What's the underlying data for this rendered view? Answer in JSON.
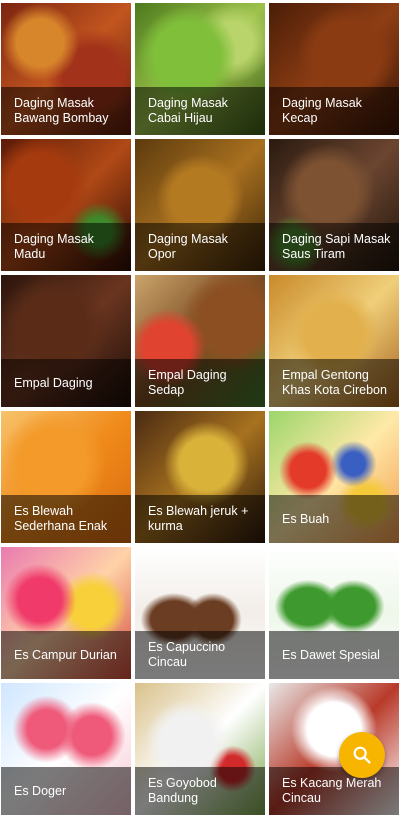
{
  "recipes": [
    {
      "title": "Daging Masak Bawang Bombay"
    },
    {
      "title": "Daging Masak Cabai Hijau"
    },
    {
      "title": "Daging Masak Kecap"
    },
    {
      "title": "Daging Masak Madu"
    },
    {
      "title": "Daging Masak Opor"
    },
    {
      "title": "Daging Sapi Masak Saus Tiram"
    },
    {
      "title": "Empal Daging"
    },
    {
      "title": "Empal Daging Sedap"
    },
    {
      "title": "Empal Gentong Khas Kota Cirebon"
    },
    {
      "title": "Es Blewah Sederhana Enak"
    },
    {
      "title": "Es Blewah jeruk + kurma"
    },
    {
      "title": "Es Buah"
    },
    {
      "title": "Es Campur Durian"
    },
    {
      "title": "Es Capuccino Cincau"
    },
    {
      "title": "Es Dawet Spesial"
    },
    {
      "title": "Es Doger"
    },
    {
      "title": "Es Goyobod Bandung"
    },
    {
      "title": "Es Kacang Merah Cincau"
    }
  ],
  "fab": {
    "icon": "search-icon",
    "color": "#f7b500"
  }
}
